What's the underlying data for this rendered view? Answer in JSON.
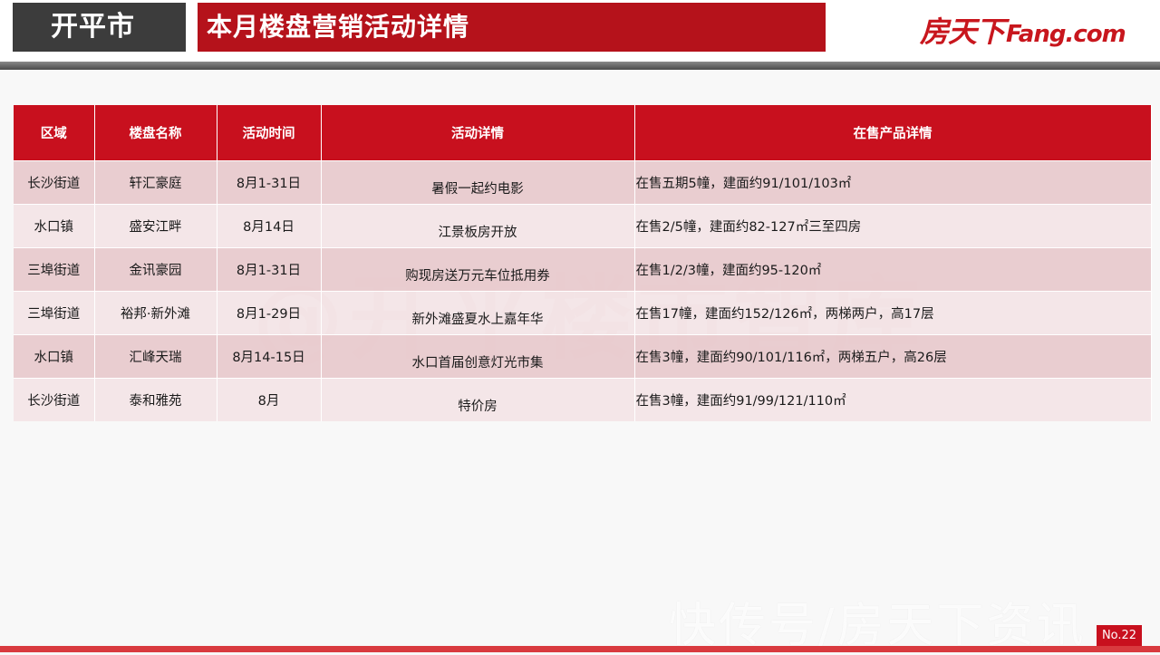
{
  "header": {
    "city": "开平市",
    "title": "本月楼盘营销活动详情",
    "logo_cn": "房天下",
    "logo_en": "Fang.com"
  },
  "watermark": "@开平楼市智库",
  "table": {
    "headers": [
      "区域",
      "楼盘名称",
      "活动时间",
      "活动详情",
      "在售产品详情"
    ],
    "rows": [
      [
        "长沙街道",
        "轩汇豪庭",
        "8月1-31日",
        "暑假一起约电影",
        "在售五期5幢，建面约91/101/103㎡"
      ],
      [
        "水口镇",
        "盛安江畔",
        "8月14日",
        "江景板房开放",
        "在售2/5幢，建面约82-127㎡三至四房"
      ],
      [
        "三埠街道",
        "金讯豪园",
        "8月1-31日",
        "购现房送万元车位抵用券",
        "在售1/2/3幢，建面约95-120㎡"
      ],
      [
        "三埠街道",
        "裕邦·新外滩",
        "8月1-29日",
        "新外滩盛夏水上嘉年华",
        "在售17幢，建面约152/126㎡，两梯两户，高17层"
      ],
      [
        "水口镇",
        "汇峰天瑞",
        "8月14-15日",
        "水口首届创意灯光市集",
        "在售3幢，建面约90/101/116㎡，两梯五户，高26层"
      ],
      [
        "长沙街道",
        "泰和雅苑",
        "8月",
        "特价房",
        "在售3幢，建面约91/99/121/110㎡"
      ]
    ]
  },
  "corner_watermark": "快传号/房天下资讯",
  "page_number": "No.22",
  "colors": {
    "brand_red": "#c8101e",
    "header_dark": "#3c3c3c",
    "row_odd": "#e8cacd",
    "row_even": "#f3e3e5"
  }
}
